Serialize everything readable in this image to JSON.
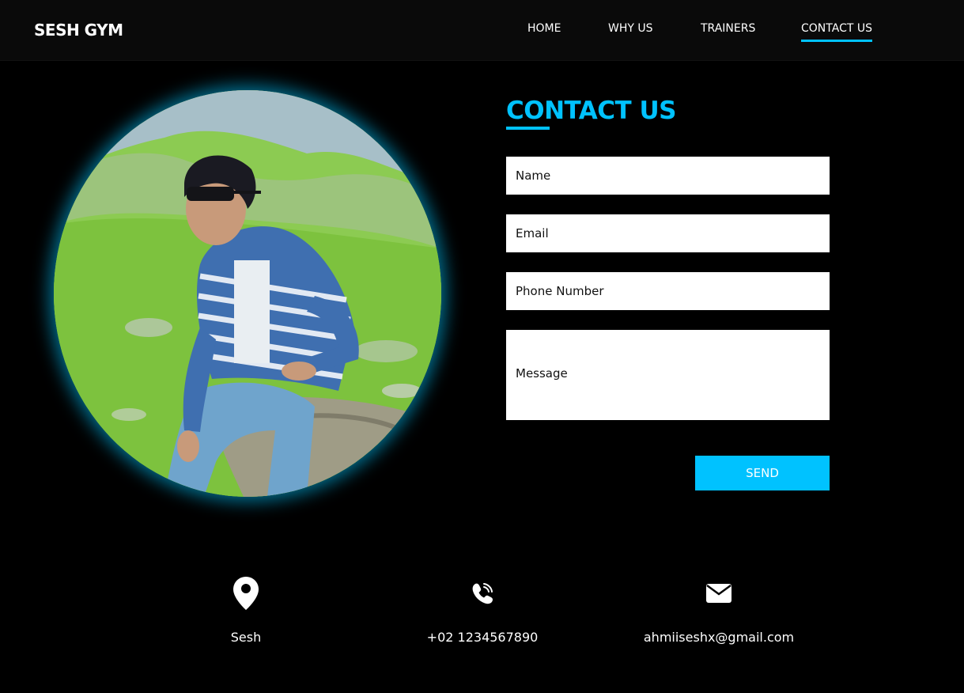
{
  "header": {
    "logo": "SESH GYM",
    "nav": [
      {
        "label": "HOME"
      },
      {
        "label": "WHY US"
      },
      {
        "label": "TRAINERS"
      },
      {
        "label": "CONTACT US",
        "active": true
      }
    ]
  },
  "contact": {
    "title": "CONTACT US",
    "fields": {
      "name_placeholder": "Name",
      "email_placeholder": "Email",
      "phone_placeholder": "Phone Number",
      "message_placeholder": "Message"
    },
    "send_label": "SEND"
  },
  "info": {
    "location": {
      "icon": "map-pin-icon",
      "text": "Sesh"
    },
    "phone": {
      "icon": "phone-icon",
      "text": "+02 1234567890"
    },
    "email": {
      "icon": "envelope-icon",
      "text": "ahmiiseshx@gmail.com"
    }
  },
  "colors": {
    "accent": "#00c2ff",
    "background": "#000000",
    "header_bg": "#0a0a0a"
  }
}
